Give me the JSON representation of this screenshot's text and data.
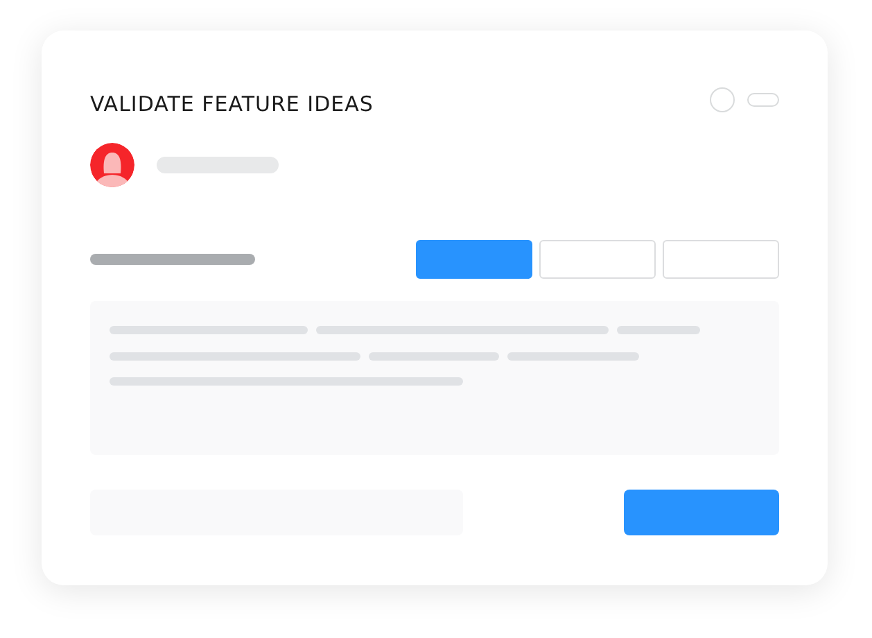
{
  "title": "VALIDATE FEATURE IDEAS",
  "options": [
    {
      "selected": true
    },
    {
      "selected": false
    },
    {
      "selected": false
    }
  ]
}
